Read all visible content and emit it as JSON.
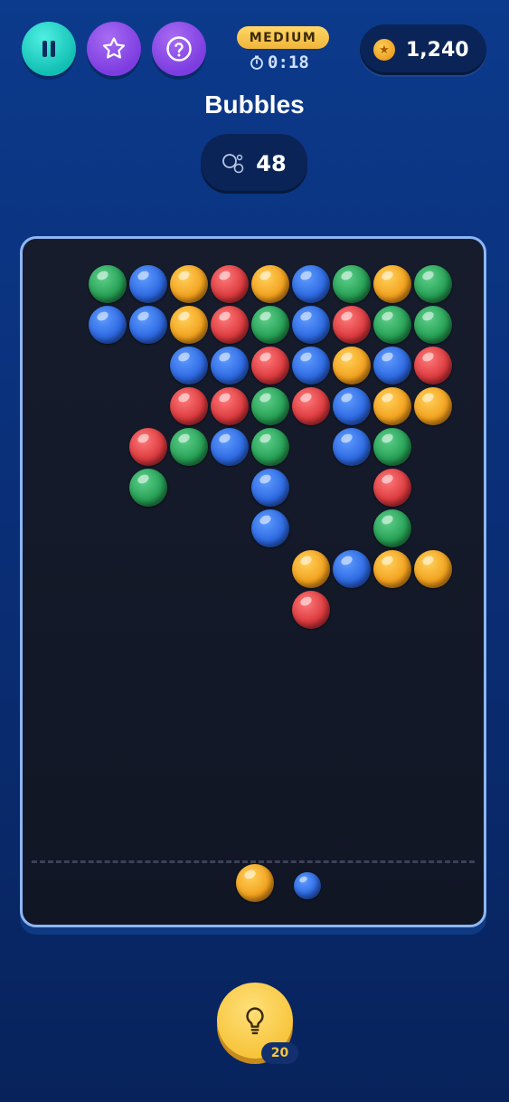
{
  "header": {
    "difficulty": "MEDIUM",
    "timer": "0:18",
    "coins": "1,240",
    "title": "Bubbles",
    "bubbles_left": "48"
  },
  "icons": {
    "pause": "pause-icon",
    "star": "star-icon",
    "help": "question-icon",
    "timer": "stopwatch-icon",
    "coin": "coin-star-icon",
    "bubbles": "bubbles-icon",
    "hint": "lightbulb-icon"
  },
  "colors": {
    "green": "#27a055",
    "blue": "#2e6ae2",
    "orange": "#f3a21f",
    "red": "#dc3b3f"
  },
  "board": {
    "rows": [
      [
        "",
        "",
        "G",
        "B",
        "O",
        "R",
        "O",
        "B",
        "G",
        "O",
        "G"
      ],
      [
        "",
        "",
        "B",
        "B",
        "O",
        "R",
        "G",
        "B",
        "R",
        "G",
        "G"
      ],
      [
        "",
        "",
        "",
        "",
        "B",
        "B",
        "R",
        "B",
        "O",
        "B",
        "R"
      ],
      [
        "",
        "",
        "",
        "",
        "R",
        "R",
        "G",
        "R",
        "B",
        "O",
        "O"
      ],
      [
        "",
        "",
        "",
        "R",
        "G",
        "B",
        "G",
        "",
        "B",
        "G",
        ""
      ],
      [
        "",
        "",
        "",
        "G",
        "",
        "",
        "B",
        "",
        "",
        "R",
        ""
      ],
      [
        "",
        "",
        "",
        "",
        "",
        "",
        "B",
        "",
        "",
        "G",
        ""
      ],
      [
        "",
        "",
        "",
        "",
        "",
        "",
        "",
        "O",
        "B",
        "O",
        "O"
      ],
      [
        "",
        "",
        "",
        "",
        "",
        "",
        "",
        "R",
        "",
        "",
        ""
      ]
    ],
    "current_ball": "O",
    "next_ball": "B"
  },
  "hint": {
    "count": "20"
  }
}
